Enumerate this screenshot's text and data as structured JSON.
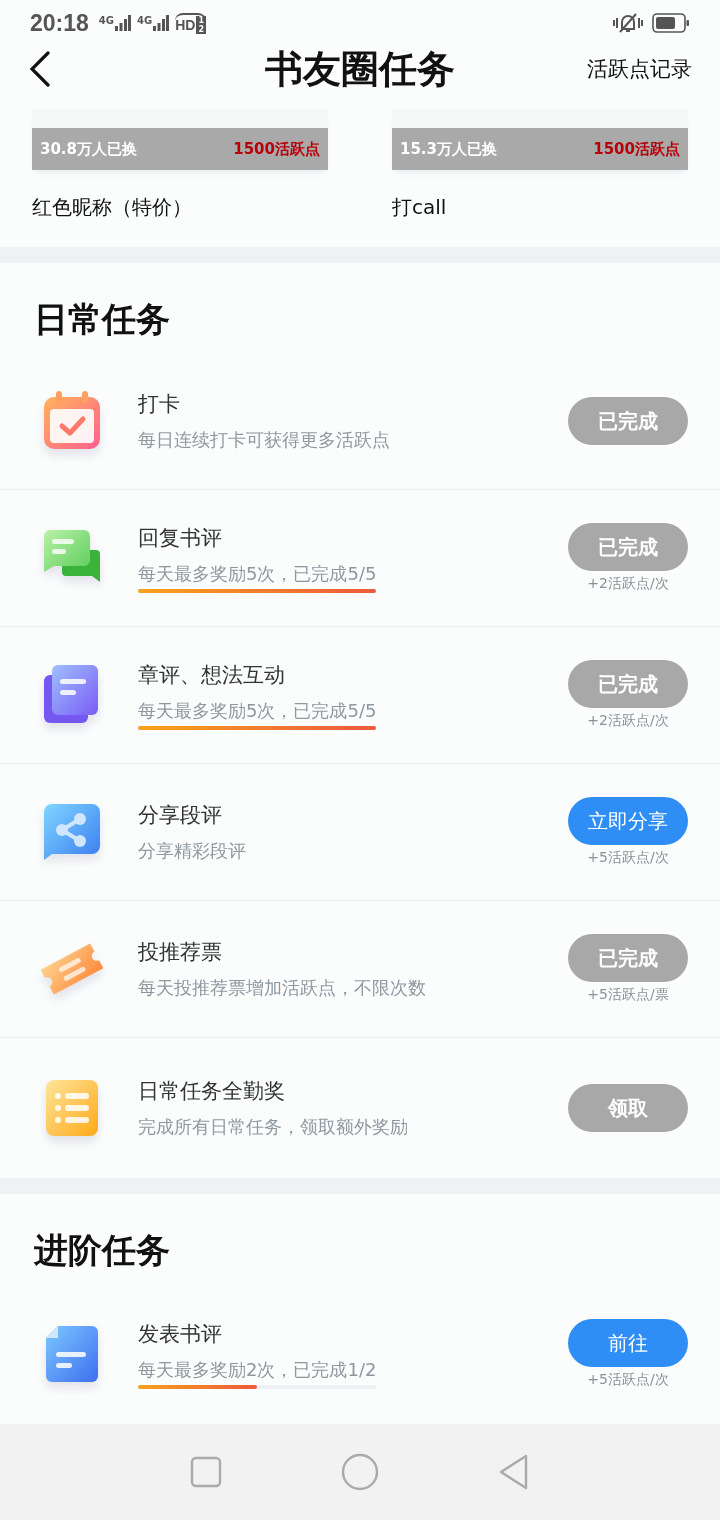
{
  "status_bar": {
    "time": "20:18",
    "networks": [
      "4G",
      "4G"
    ],
    "hd": "HD",
    "hd_slots": [
      "1",
      "2"
    ]
  },
  "header": {
    "title": "书友圈任务",
    "action": "活跃点记录"
  },
  "rewards": [
    {
      "count": "30.8万人已换",
      "price": "1500活跃点",
      "name": "红色昵称（特价）"
    },
    {
      "count": "15.3万人已换",
      "price": "1500活跃点",
      "name": "打call"
    }
  ],
  "sections": [
    {
      "title": "日常任务",
      "tasks": [
        {
          "title": "打卡",
          "subtitle": "每日连续打卡可获得更多活跃点",
          "button": {
            "label": "已完成",
            "enabled": false
          }
        },
        {
          "title": "回复书评",
          "subtitle": "每天最多奖励5次，已完成5/5",
          "level": 1,
          "button": {
            "label": "已完成",
            "enabled": false
          },
          "reward": "+2活跃点/次"
        },
        {
          "title": "章评、想法互动",
          "subtitle": "每天最多奖励5次，已完成5/5",
          "level": 1,
          "button": {
            "label": "已完成",
            "enabled": false
          },
          "reward": "+2活跃点/次"
        },
        {
          "title": "分享段评",
          "subtitle": "分享精彩段评",
          "button": {
            "label": "立即分享",
            "enabled": true
          },
          "reward": "+5活跃点/次"
        },
        {
          "title": "投推荐票",
          "subtitle": "每天投推荐票增加活跃点，不限次数",
          "button": {
            "label": "已完成",
            "enabled": false
          },
          "reward": "+5活跃点/票"
        },
        {
          "title": "日常任务全勤奖",
          "subtitle": "完成所有日常任务，领取额外奖励",
          "button": {
            "label": "领取",
            "enabled": false
          }
        }
      ]
    },
    {
      "title": "进阶任务",
      "tasks": [
        {
          "title": "发表书评",
          "subtitle": "每天最多奖励2次，已完成1/2",
          "level": 0.5,
          "button": {
            "label": "前往",
            "enabled": true
          },
          "reward": "+5活跃点/次"
        }
      ]
    }
  ]
}
